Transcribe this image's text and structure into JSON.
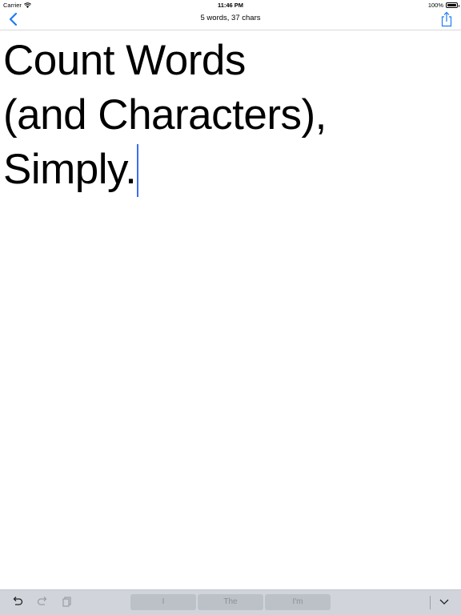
{
  "status_bar": {
    "carrier": "Carrier",
    "time": "11:46 PM",
    "battery": "100%"
  },
  "nav": {
    "title": "5 words, 37 chars",
    "back_icon": "chevron-left-icon",
    "share_icon": "share-icon"
  },
  "editor": {
    "lines": [
      "Count Words",
      "(and Characters),",
      "Simply."
    ]
  },
  "accessory": {
    "suggestions": [
      "I",
      "The",
      "I'm"
    ],
    "undo_icon": "undo-icon",
    "redo_icon": "redo-icon",
    "paste_icon": "paste-icon",
    "dismiss_icon": "chevron-down-icon"
  },
  "colors": {
    "accent": "#1f7cf5",
    "caret": "#3b6df0",
    "accessory_bg": "#d1d5db"
  }
}
